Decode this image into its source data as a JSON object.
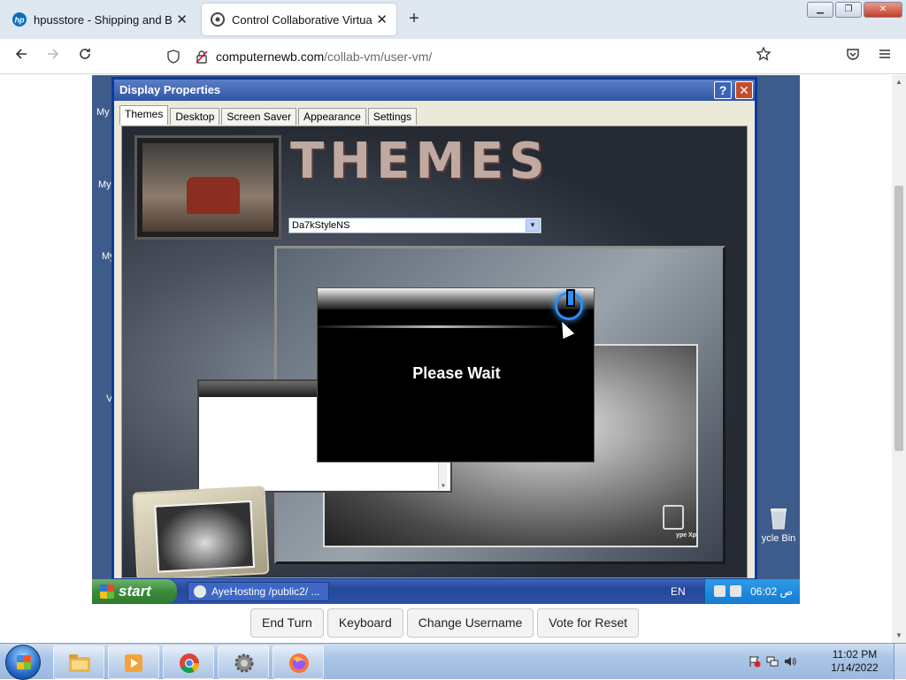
{
  "browser": {
    "tabs": [
      {
        "title": "hpusstore - Shipping and Billing",
        "close": "✕",
        "active": false
      },
      {
        "title": "Control Collaborative Virtual M",
        "close": "✕",
        "active": true
      }
    ],
    "new_tab": "+",
    "window_buttons": {
      "minimize": "▁",
      "maximize": "❐",
      "close": "✕"
    },
    "url": {
      "host": "computernewb.com",
      "path": "/collab-vm/user-vm/"
    }
  },
  "vm": {
    "desktop_labels": [
      "My",
      "My",
      "My",
      "V"
    ],
    "recycle_bin": "ycle Bin",
    "dialog": {
      "title": "Display Properties",
      "help": "?",
      "close": "✕",
      "tabs": [
        "Themes",
        "Desktop",
        "Screen Saver",
        "Appearance",
        "Settings"
      ],
      "active_tab": "Themes",
      "banner": "THEMES",
      "theme_selected": "Da7kStyleNS",
      "wait_message": "Please Wait",
      "mini_window_close": "✕",
      "mini_recycle_label": "ype Xp"
    },
    "taskbar": {
      "start": "start",
      "task": "AyeHosting /public2/ ...",
      "language": "EN",
      "clock": "06:02 ص"
    }
  },
  "controls": [
    "End Turn",
    "Keyboard",
    "Change Username",
    "Vote for Reset"
  ],
  "win7": {
    "clock_time": "11:02 PM",
    "clock_date": "1/14/2022",
    "pinned": [
      "file-explorer",
      "media-player",
      "chrome",
      "settings-gear",
      "firefox"
    ]
  },
  "colors": {
    "vm_desktop": "#3e5c8b",
    "xp_title": "#2f55a4",
    "win7_taskbar": "#a9c4e6"
  }
}
